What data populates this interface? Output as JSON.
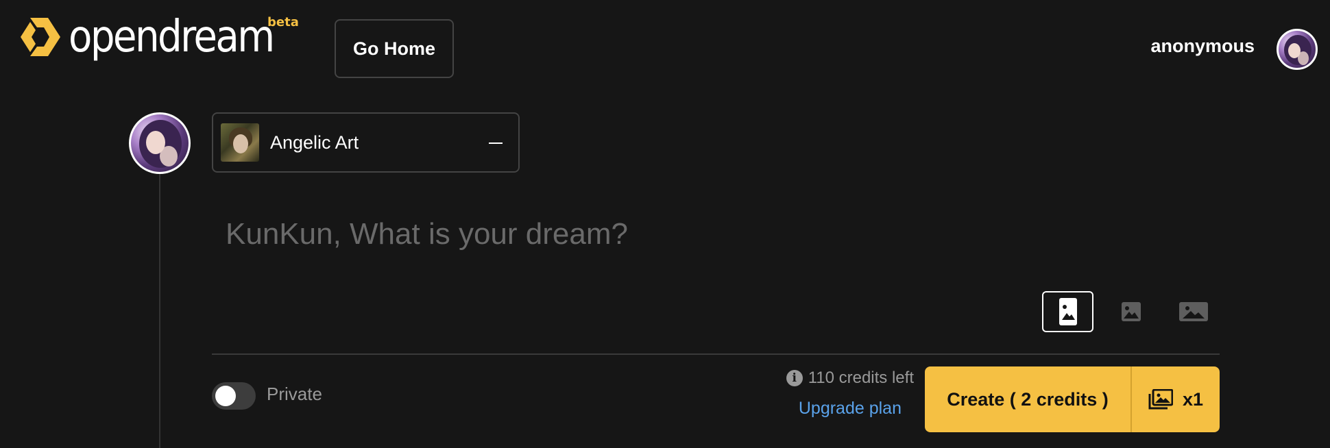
{
  "header": {
    "brand": "opendream",
    "beta_badge": "beta",
    "go_home_label": "Go Home",
    "username": "anonymous"
  },
  "composer": {
    "style_label": "Angelic Art",
    "prompt_placeholder": "KunKun, What is your dream?",
    "aspect_ratios": [
      "portrait",
      "square",
      "landscape"
    ],
    "selected_ratio": "portrait",
    "private_label": "Private",
    "private_enabled": false,
    "credits_left": "110 credits left",
    "upgrade_label": "Upgrade plan",
    "create_label": "Create ( 2 credits )",
    "image_count": "x1"
  },
  "colors": {
    "accent": "#f5c043",
    "link": "#5aa2ea",
    "background": "#161616"
  }
}
